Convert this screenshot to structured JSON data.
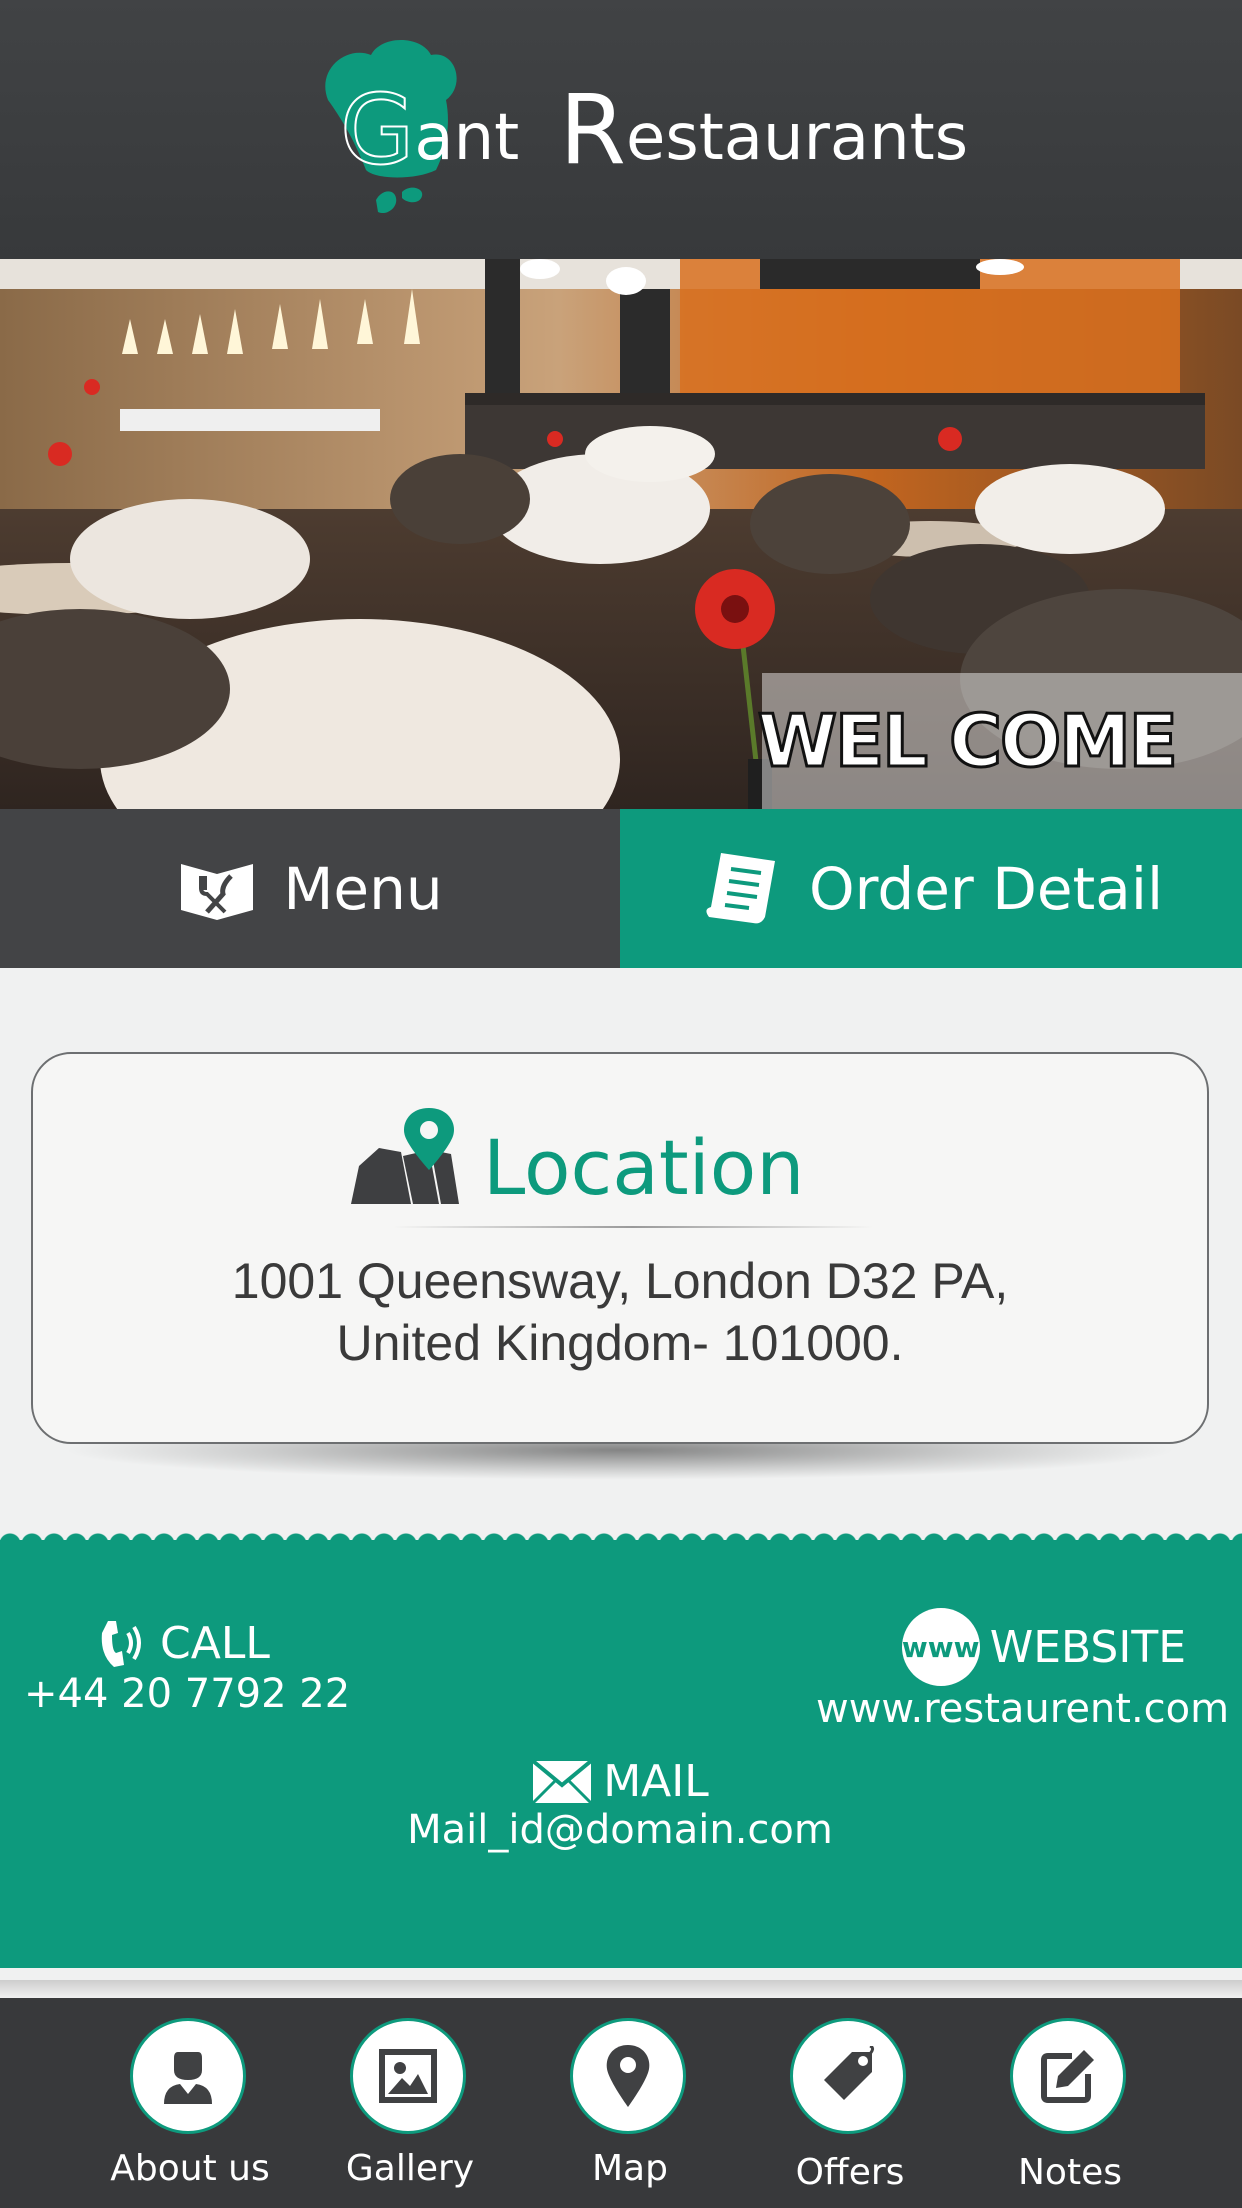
{
  "brand": {
    "name_first": "G",
    "name_rest1": "ant ",
    "name_second_cap": "R",
    "name_rest2": "estaurants",
    "logo_icon": "chef-hat-icon"
  },
  "hero": {
    "image": "restaurant-interior-photo",
    "welcome_text": "WEL COME"
  },
  "tabs": {
    "menu": {
      "label": "Menu",
      "icon": "cutlery-icon"
    },
    "order": {
      "label": "Order Detail",
      "icon": "receipt-icon"
    }
  },
  "location": {
    "title": "Location",
    "icon": "map-pin-icon",
    "address_line1": "1001 Queensway, London D32 PA,",
    "address_line2": "United Kingdom- 101000."
  },
  "contact": {
    "call": {
      "label": "CALL",
      "value": "+44 20 7792 22",
      "icon": "phone-icon"
    },
    "website": {
      "label": "WEBSITE",
      "value": "www.restaurent.com",
      "icon": "www-icon",
      "icon_text": "www"
    },
    "mail": {
      "label": "MAIL",
      "value": "Mail_id@domain.com",
      "icon": "envelope-icon"
    }
  },
  "bottom_nav": {
    "items": [
      {
        "label": "About us",
        "icon": "user-icon"
      },
      {
        "label": "Gallery",
        "icon": "image-icon"
      },
      {
        "label": "Map",
        "icon": "map-pin-icon"
      },
      {
        "label": "Offers",
        "icon": "tag-icon"
      },
      {
        "label": "Notes",
        "icon": "edit-icon"
      }
    ]
  },
  "colors": {
    "accent": "#0d9a7d",
    "dark": "#38393b",
    "background": "#f0f1f1"
  }
}
